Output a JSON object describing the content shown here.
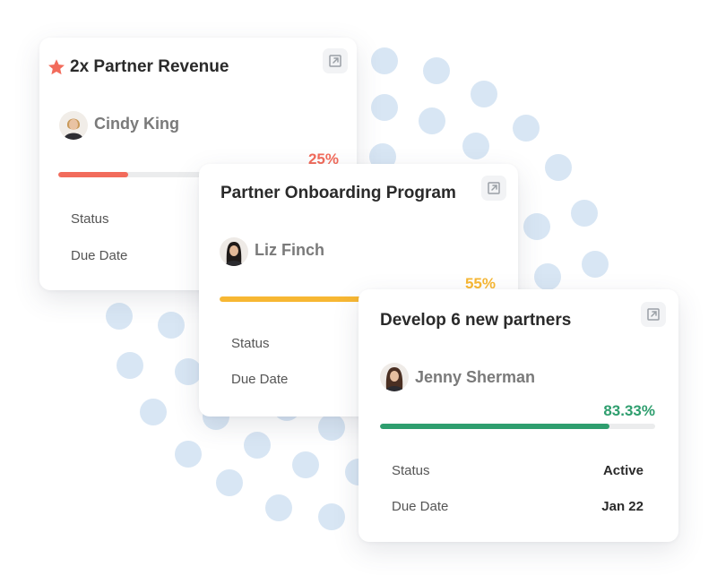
{
  "cards": [
    {
      "title": "2x Partner Revenue",
      "owner": "Cindy King",
      "progress_text": "25%",
      "progress": 0.25,
      "progress_color": "#f26b5b",
      "status_label": "Status",
      "due_label": "Due Date"
    },
    {
      "title": "Partner Onboarding Program",
      "owner": "Liz Finch",
      "progress_text": "55%",
      "progress": 0.55,
      "progress_color": "#f7b733",
      "status_label": "Status",
      "due_label": "Due Date"
    },
    {
      "title": "Develop 6 new partners",
      "owner": "Jenny Sherman",
      "progress_text": "83.33%",
      "progress": 0.8333,
      "progress_color": "#2e9e6e",
      "status_label": "Status",
      "status_value": "Active",
      "due_label": "Due Date",
      "due_value": "Jan 22"
    }
  ],
  "colors": {
    "dot": "#d8e6f4",
    "star": "#f26b5b",
    "progress_track": "#ebeced"
  },
  "icons": {
    "expand": "expand-arrow-icon",
    "star": "star-icon"
  }
}
